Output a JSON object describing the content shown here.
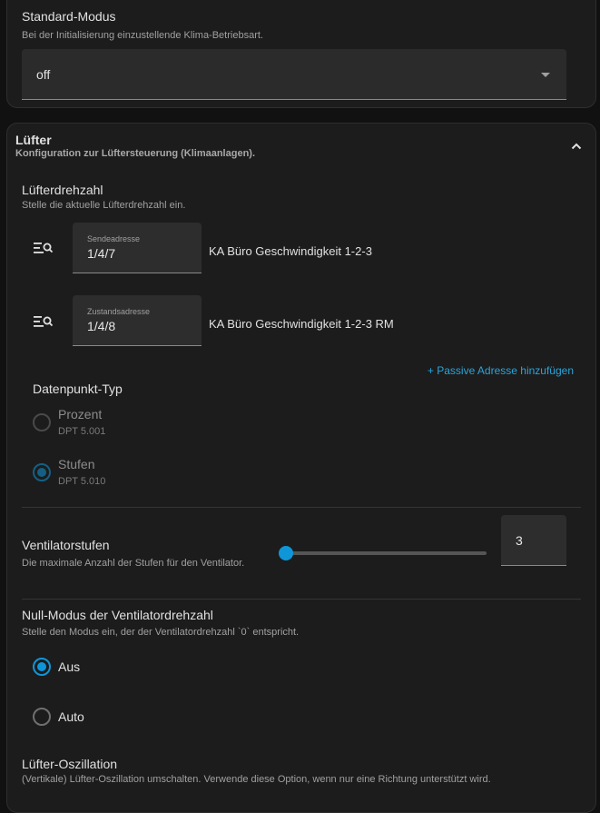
{
  "standard_mode": {
    "label": "Standard-Modus",
    "description": "Bei der Initialisierung einzustellende Klima-Betriebsart.",
    "value": "off"
  },
  "fan": {
    "title": "Lüfter",
    "description": "Konfiguration zur Lüftersteuerung (Klimaanlagen).",
    "speed": {
      "label": "Lüfterdrehzahl",
      "description": "Stelle die aktuelle Lüfterdrehzahl ein.",
      "send_address": {
        "label": "Sendeadresse",
        "value": "1/4/7",
        "name": "KA Büro Geschwindigkeit 1-2-3"
      },
      "state_address": {
        "label": "Zustandsadresse",
        "value": "1/4/8",
        "name": "KA Büro Geschwindigkeit 1-2-3 RM"
      },
      "add_passive_link": "+ Passive Adresse hinzufügen",
      "dpt_label": "Datenpunkt-Typ",
      "dpt_options": [
        {
          "label": "Prozent",
          "sub": "DPT 5.001",
          "selected": false
        },
        {
          "label": "Stufen",
          "sub": "DPT 5.010",
          "selected": true
        }
      ]
    },
    "steps": {
      "label": "Ventilatorstufen",
      "description": "Die maximale Anzahl der Stufen für den Ventilator.",
      "value": "3"
    },
    "zero_mode": {
      "label": "Null-Modus der Ventilatordrehzahl",
      "description": "Stelle den Modus ein, der der Ventilatordrehzahl `0` entspricht.",
      "options": [
        {
          "label": "Aus",
          "selected": true
        },
        {
          "label": "Auto",
          "selected": false
        }
      ]
    },
    "oscillation": {
      "label": "Lüfter-Oszillation",
      "description": "(Vertikale) Lüfter-Oszillation umschalten. Verwende diese Option, wenn nur eine Richtung unterstützt wird."
    }
  },
  "colors": {
    "accent": "#0f96d8",
    "link": "#2aa5db",
    "background": "#111111",
    "card": "#1c1c1c"
  },
  "icons": {
    "ga_search": "list-search-icon",
    "collapse": "chevron-up-icon",
    "select_caret": "caret-down-icon"
  }
}
